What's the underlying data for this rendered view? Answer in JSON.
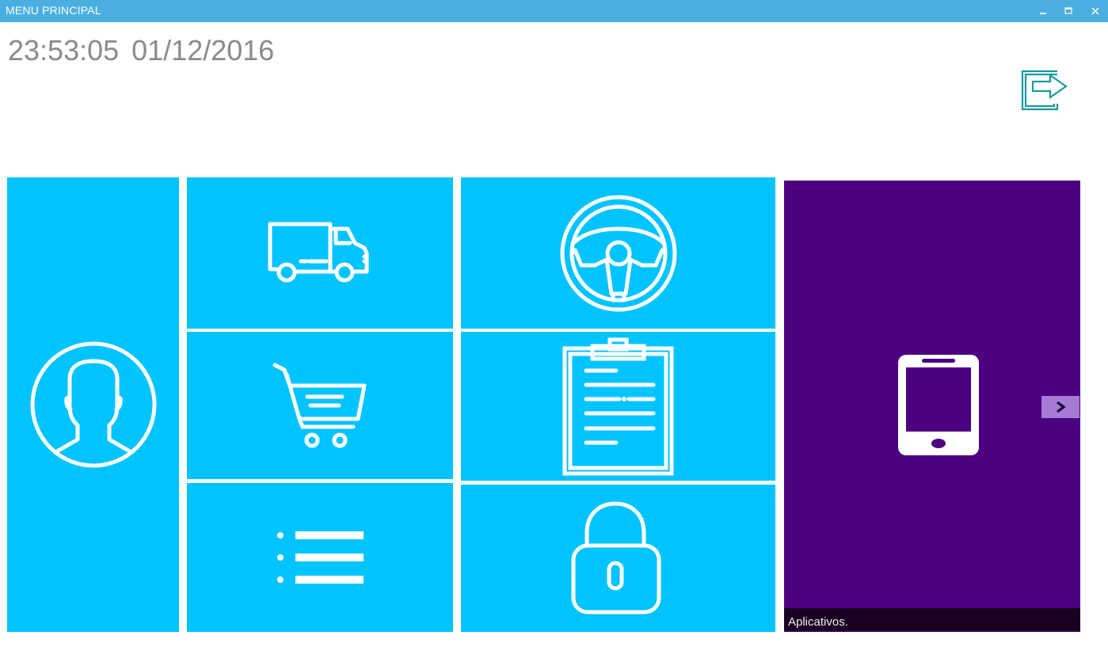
{
  "window": {
    "title": "MENU PRINCIPAL",
    "controls": [
      "minimize",
      "maximize",
      "close"
    ]
  },
  "header": {
    "time": "23:53:05",
    "date": "01/12/2016"
  },
  "exit": {
    "icon": "exit-icon"
  },
  "tiles": [
    {
      "id": "user",
      "icon": "user-icon"
    },
    {
      "id": "truck",
      "icon": "truck-icon"
    },
    {
      "id": "cart",
      "icon": "cart-icon"
    },
    {
      "id": "list",
      "icon": "list-icon"
    },
    {
      "id": "wheel",
      "icon": "steering-wheel-icon"
    },
    {
      "id": "clipboard",
      "icon": "clipboard-icon"
    },
    {
      "id": "lock",
      "icon": "lock-icon"
    },
    {
      "id": "apps",
      "icon": "smartphone-icon",
      "caption": "Aplicativos."
    }
  ],
  "colors": {
    "titlebar": "#4aafe0",
    "tile": "#00c4ff",
    "apps_tile": "#4b0082",
    "apps_caption_bg": "#1a0020",
    "next_button": "#a57bd6",
    "exit_icon": "#1a9aa0",
    "clock_text": "#8a8a8a"
  }
}
